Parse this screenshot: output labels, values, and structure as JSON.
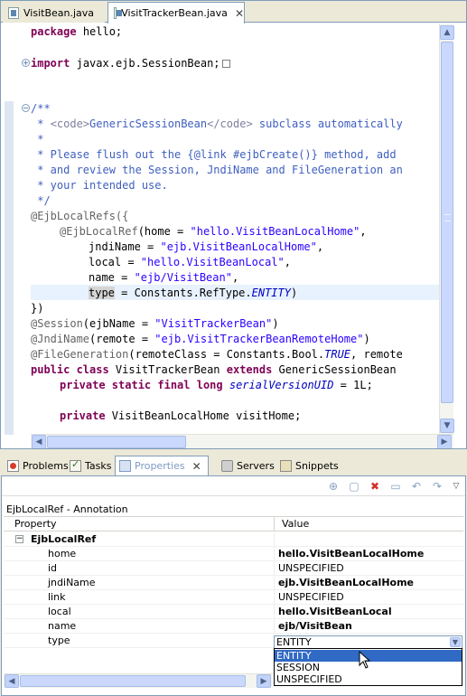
{
  "editor": {
    "tabs": [
      {
        "label": "VisitBean.java"
      },
      {
        "label": "VisitTrackerBean.java",
        "close": "✕"
      }
    ],
    "code": {
      "l_package": "hello;",
      "l_import": "javax.ejb.SessionBean;",
      "l_c1": "/**",
      "l_c2a": " * ",
      "l_c2b": "<code>",
      "l_c2c": "GenericSessionBean",
      "l_c2d": "</code>",
      "l_c2e": " subclass automatically",
      "l_c3": " *",
      "l_c4": " * Please flush out the {@link #ejbCreate()} method, add",
      "l_c5": " * and review the Session, JndiName and FileGeneration an",
      "l_c6": " * your intended use.",
      "l_c7": " */",
      "l_refs": "@EjbLocalRefs({",
      "l_ref_anno": "@EjbLocalRef",
      "l_ref_rest": "(home = ",
      "l_ref_home": "\"hello.VisitBeanLocalHome\"",
      "l_jndi_key": "jndiName = ",
      "l_jndi_val": "\"ejb.VisitBeanLocalHome\"",
      "l_local_key": "local = ",
      "l_local_val": "\"hello.VisitBeanLocal\"",
      "l_name_key": "name = ",
      "l_name_val": "\"ejb/VisitBean\"",
      "l_type_key": "type",
      "l_type_mid": " = Constants.RefType.",
      "l_type_val": "ENTITY",
      "l_close": "})",
      "l_session_anno": "@Session",
      "l_session_mid": "(ejbName = ",
      "l_session_val": "\"VisitTrackerBean\"",
      "l_jndiname_anno": "@JndiName",
      "l_jndiname_mid": "(remote = ",
      "l_jndiname_val": "\"ejb.VisitTrackerBeanRemoteHome\"",
      "l_filegen_anno": "@FileGeneration",
      "l_filegen_mid": "(remoteClass = Constants.Bool.",
      "l_filegen_true": "TRUE",
      "l_filegen_end": ", remote",
      "l_class_kw1": "public class",
      "l_class_mid": " VisitTrackerBean ",
      "l_class_kw2": "extends",
      "l_class_end": " GenericSessionBean",
      "l_serial_kw": "private static final long",
      "l_serial_field": "serialVersionUID",
      "l_serial_end": " = 1L;",
      "l_home_kw": "private",
      "l_home_rest": " VisitBeanLocalHome visitHome;",
      "kw_package": "package",
      "kw_import": "import"
    },
    "scroll": {
      "up": "▲",
      "down": "▼",
      "left": "◀",
      "right": "▶"
    }
  },
  "views": {
    "tabs": [
      {
        "label": "Problems"
      },
      {
        "label": "Tasks"
      },
      {
        "label": "Properties",
        "close": "✕"
      },
      {
        "label": "Servers"
      },
      {
        "label": "Snippets"
      }
    ],
    "toolbar": {
      "delete": "✖",
      "menu": "▽"
    }
  },
  "properties": {
    "section_title": "EjbLocalRef - Annotation",
    "columns": {
      "property": "Property",
      "value": "Value"
    },
    "group": {
      "toggle": "−",
      "name": "EjbLocalRef"
    },
    "rows": [
      {
        "name": "home",
        "value": "hello.VisitBeanLocalHome"
      },
      {
        "name": "id",
        "value": "UNSPECIFIED"
      },
      {
        "name": "jndiName",
        "value": "ejb.VisitBeanLocalHome"
      },
      {
        "name": "link",
        "value": "UNSPECIFIED"
      },
      {
        "name": "local",
        "value": "hello.VisitBeanLocal"
      },
      {
        "name": "name",
        "value": "ejb/VisitBean"
      },
      {
        "name": "type",
        "value": "ENTITY"
      }
    ],
    "combo": {
      "arrow": "▼",
      "options": [
        "ENTITY",
        "SESSION",
        "UNSPECIFIED"
      ],
      "selected": "ENTITY"
    }
  }
}
